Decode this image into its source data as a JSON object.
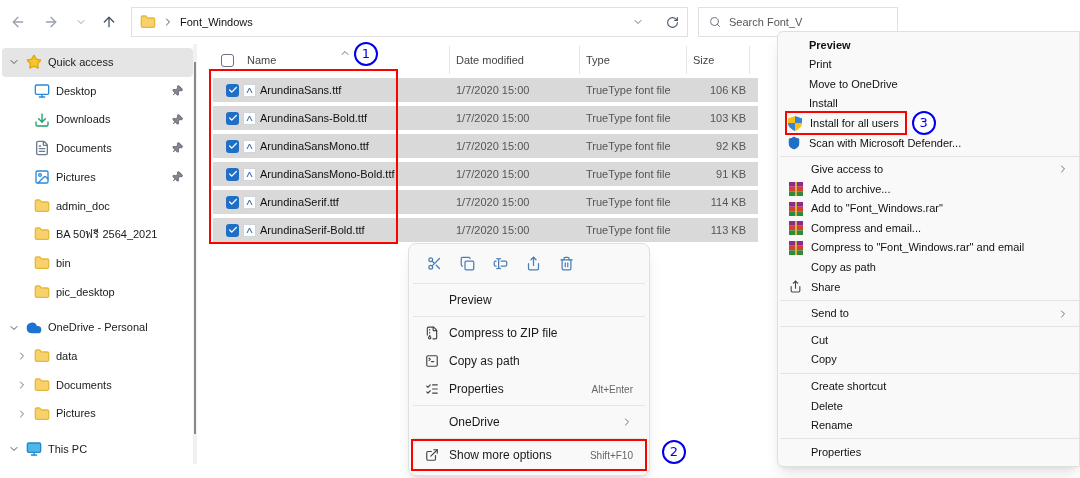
{
  "address_bar": {
    "path": "Font_Windows"
  },
  "search": {
    "placeholder": "Search Font_V"
  },
  "sidebar": {
    "sections": [
      {
        "label": "Quick access",
        "kind": "star",
        "expanded": true,
        "selected": true,
        "children": [
          {
            "label": "Desktop",
            "kind": "desktop",
            "pinned": true
          },
          {
            "label": "Downloads",
            "kind": "download",
            "pinned": true
          },
          {
            "label": "Documents",
            "kind": "documents",
            "pinned": true
          },
          {
            "label": "Pictures",
            "kind": "pictures",
            "pinned": true
          },
          {
            "label": "admin_doc",
            "kind": "folder",
            "pinned": false
          },
          {
            "label": "BA 50ฟรี 2564_2021",
            "kind": "folder",
            "pinned": false
          },
          {
            "label": "bin",
            "kind": "folder",
            "pinned": false
          },
          {
            "label": "pic_desktop",
            "kind": "folder",
            "pinned": false
          }
        ]
      },
      {
        "label": "OneDrive - Personal",
        "kind": "cloud",
        "expanded": true,
        "selected": false,
        "children": [
          {
            "label": "data",
            "kind": "folder",
            "expandable": true
          },
          {
            "label": "Documents",
            "kind": "folder",
            "expandable": true
          },
          {
            "label": "Pictures",
            "kind": "folder",
            "expandable": true
          }
        ]
      },
      {
        "label": "This PC",
        "kind": "pc",
        "expanded": true,
        "selected": false
      }
    ]
  },
  "file_list": {
    "header_checked": false,
    "columns": [
      {
        "label": "Name",
        "sorted": true
      },
      {
        "label": "Date modified",
        "sorted": false
      },
      {
        "label": "Type",
        "sorted": false
      },
      {
        "label": "Size",
        "sorted": false
      }
    ],
    "rows": [
      {
        "name": "ArundinaSans.ttf",
        "date": "1/7/2020 15:00",
        "type": "TrueType font file",
        "size": "106 KB",
        "selected": true,
        "checked": true
      },
      {
        "name": "ArundinaSans-Bold.ttf",
        "date": "1/7/2020 15:00",
        "type": "TrueType font file",
        "size": "103 KB",
        "selected": true,
        "checked": true
      },
      {
        "name": "ArundinaSansMono.ttf",
        "date": "1/7/2020 15:00",
        "type": "TrueType font file",
        "size": "92 KB",
        "selected": true,
        "checked": true
      },
      {
        "name": "ArundinaSansMono-Bold.ttf",
        "date": "1/7/2020 15:00",
        "type": "TrueType font file",
        "size": "91 KB",
        "selected": true,
        "checked": true
      },
      {
        "name": "ArundinaSerif.ttf",
        "date": "1/7/2020 15:00",
        "type": "TrueType font file",
        "size": "114 KB",
        "selected": true,
        "checked": true
      },
      {
        "name": "ArundinaSerif-Bold.ttf",
        "date": "1/7/2020 15:00",
        "type": "TrueType font file",
        "size": "113 KB",
        "selected": true,
        "checked": true
      }
    ]
  },
  "context_menu": {
    "groups": [
      [
        {
          "label": "Preview",
          "kind": "none",
          "submenu": false
        }
      ],
      [
        {
          "label": "Compress to ZIP file",
          "kind": "zip",
          "submenu": false
        },
        {
          "label": "Copy as path",
          "kind": "path",
          "submenu": false
        },
        {
          "label": "Properties",
          "kind": "properties",
          "shortcut": "Alt+Enter",
          "submenu": false
        }
      ],
      [
        {
          "label": "OneDrive",
          "kind": "none",
          "submenu": true
        }
      ],
      [
        {
          "label": "Show more options",
          "kind": "more",
          "shortcut": "Shift+F10",
          "submenu": false
        }
      ]
    ]
  },
  "classic_menu": {
    "default_item": {
      "label": "Preview"
    },
    "groups": [
      [
        {
          "label": "Print",
          "kind": "none",
          "submenu": false
        },
        {
          "label": "Move to OneDrive",
          "kind": "none",
          "submenu": false
        },
        {
          "label": "Install",
          "kind": "none",
          "submenu": false
        },
        {
          "label": "Install for all users",
          "kind": "uac",
          "submenu": false
        },
        {
          "label": "Scan with Microsoft Defender...",
          "kind": "defender",
          "submenu": false
        }
      ],
      [
        {
          "label": "Give access to",
          "kind": "none",
          "submenu": true
        },
        {
          "label": "Add to archive...",
          "kind": "winrar",
          "submenu": false
        },
        {
          "label": "Add to \"Font_Windows.rar\"",
          "kind": "winrar",
          "submenu": false
        },
        {
          "label": "Compress and email...",
          "kind": "winrar",
          "submenu": false
        },
        {
          "label": "Compress to \"Font_Windows.rar\" and email",
          "kind": "winrar",
          "submenu": false
        },
        {
          "label": "Copy as path",
          "kind": "none",
          "submenu": false
        },
        {
          "label": "Share",
          "kind": "share",
          "submenu": false
        }
      ],
      [
        {
          "label": "Send to",
          "kind": "none",
          "submenu": true
        }
      ],
      [
        {
          "label": "Cut",
          "kind": "none",
          "submenu": false
        },
        {
          "label": "Copy",
          "kind": "none",
          "submenu": false
        }
      ],
      [
        {
          "label": "Create shortcut",
          "kind": "none",
          "submenu": false
        },
        {
          "label": "Delete",
          "kind": "none",
          "submenu": false
        },
        {
          "label": "Rename",
          "kind": "none",
          "submenu": false
        }
      ],
      [
        {
          "label": "Properties",
          "kind": "none",
          "submenu": false
        }
      ]
    ]
  },
  "annotations": [
    {
      "label": "1"
    },
    {
      "label": "2"
    },
    {
      "label": "3"
    }
  ]
}
